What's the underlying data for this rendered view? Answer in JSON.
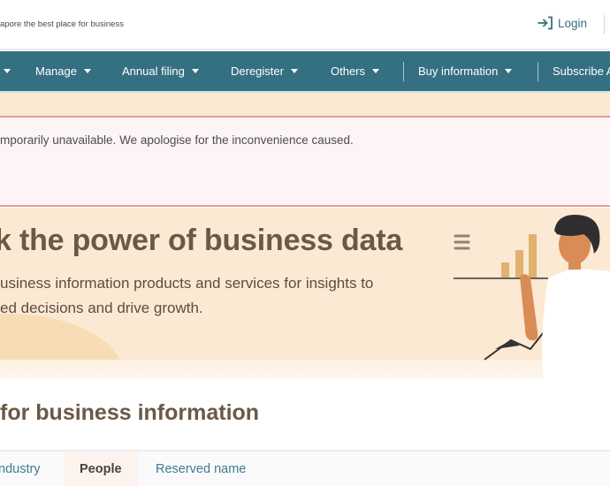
{
  "header": {
    "tagline": "apore the best place for business",
    "login_label": "Login",
    "login_icon": "login-arrow-icon"
  },
  "nav": {
    "items": [
      {
        "label": "",
        "has_caret": true
      },
      {
        "label": "Manage",
        "has_caret": true
      },
      {
        "label": "Annual filing",
        "has_caret": true
      },
      {
        "label": "Deregister",
        "has_caret": true
      },
      {
        "label": "Others",
        "has_caret": true
      },
      {
        "label": "Buy information",
        "has_caret": true
      },
      {
        "label": "Subscribe A",
        "has_caret": false
      }
    ]
  },
  "alert": {
    "message": "mporarily unavailable. We apologise for the inconvenience caused."
  },
  "hero": {
    "title": "k the power of business data",
    "subtitle_line1": "usiness information products and services for insights to",
    "subtitle_line2": "ed decisions and drive growth.",
    "illustration": "person-presenting-bar-chart"
  },
  "search_section": {
    "title": "for business information"
  },
  "tabs": [
    {
      "label": "ndustry",
      "active": false
    },
    {
      "label": "People",
      "active": true
    },
    {
      "label": "Reserved name",
      "active": false
    }
  ],
  "colors": {
    "nav_bg": "#356f82",
    "link": "#3d6e80",
    "hero_bg": "#fbe9d3",
    "heading": "#6b5846",
    "alert_border": "#e49a96",
    "alert_bg": "#fdf5f5"
  }
}
